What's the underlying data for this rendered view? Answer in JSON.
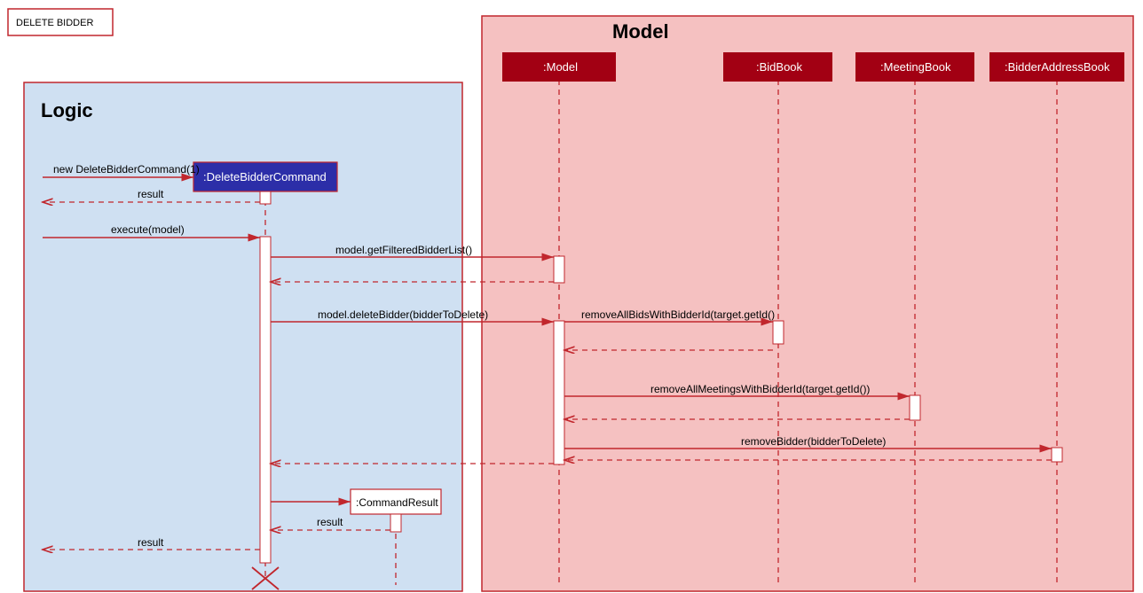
{
  "diagram": {
    "delete_bidder_label": "DELETE BIDDER",
    "logic_frame_title": "Logic",
    "model_frame_title": "Model",
    "participants": {
      "delete_cmd": ":DeleteBidderCommand",
      "command_result": ":CommandResult",
      "model": ":Model",
      "bidbook": ":BidBook",
      "meetingbook": ":MeetingBook",
      "bidder_addr_book": ":BidderAddressBook"
    },
    "messages": {
      "new_cmd": "new DeleteBidderCommand(1)",
      "result1": "result",
      "execute": "execute(model)",
      "get_filtered": "model.getFilteredBidderList()",
      "delete_bidder": "model.deleteBidder(bidderToDelete)",
      "remove_bids": "removeAllBidsWithBidderId(target.getId()",
      "remove_meetings": "removeAllMeetingsWithBidderId(target.getId())",
      "remove_bidder": "removeBidder(bidderToDelete)",
      "result2": "result",
      "result3": "result"
    },
    "colors": {
      "red_border": "#c1272d",
      "red_dark": "#a20013",
      "blue_frame_bg": "#cfe0f2",
      "blue_box": "#2c2ea8",
      "pink_bg": "#f5c1c1"
    }
  }
}
